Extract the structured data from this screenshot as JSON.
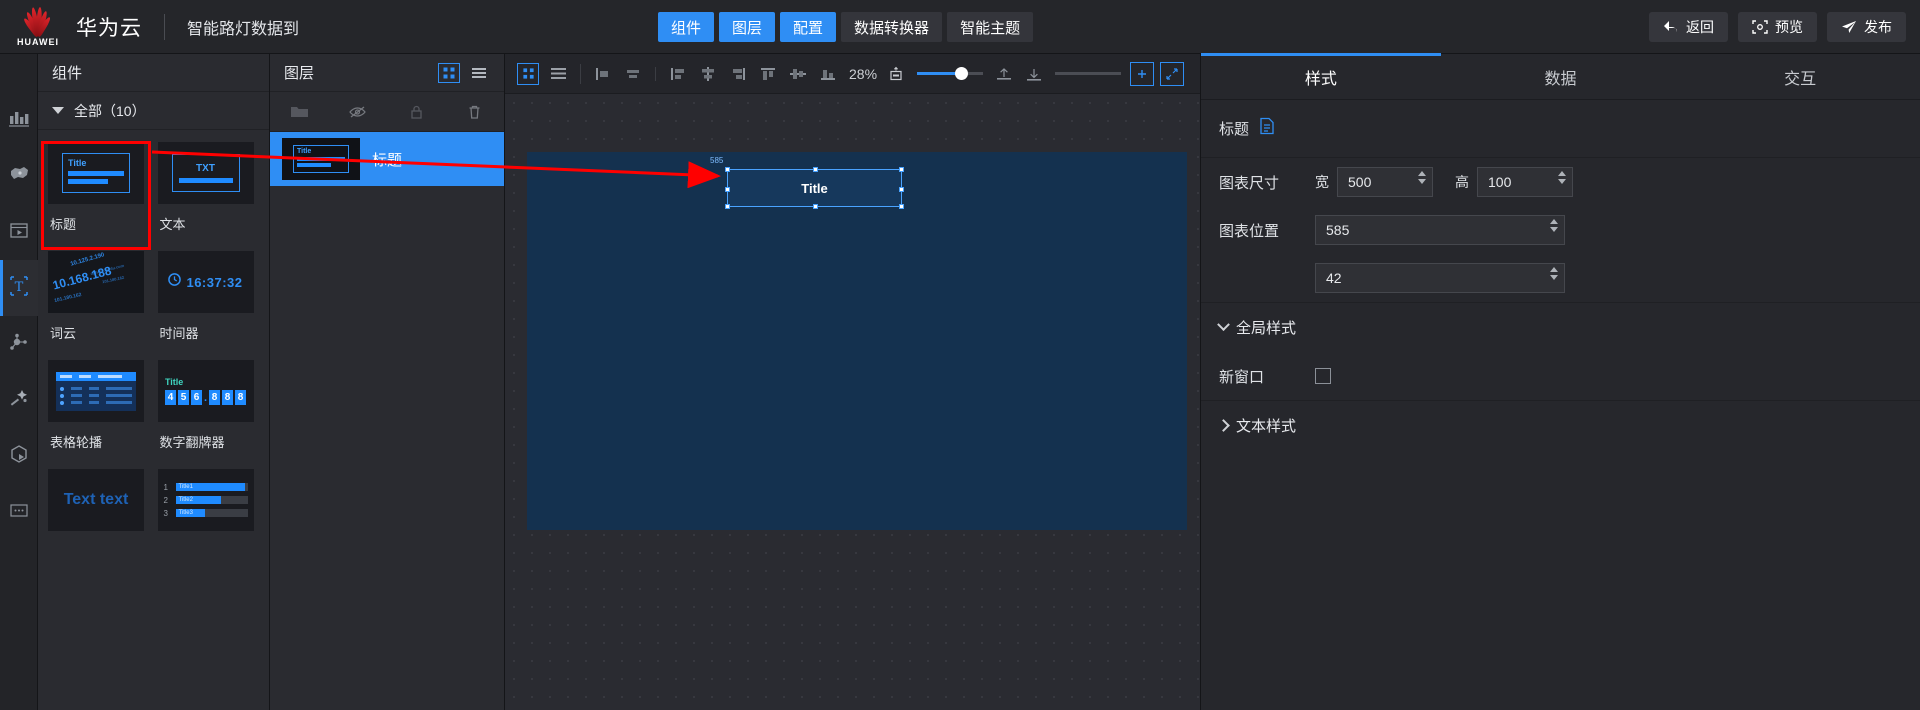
{
  "topbar": {
    "brand_name": "华为云",
    "brand_sub": "HUAWEI",
    "doc_title": "智能路灯数据到",
    "nav": [
      {
        "label": "组件",
        "active": true
      },
      {
        "label": "图层",
        "active": true
      },
      {
        "label": "配置",
        "active": true
      },
      {
        "label": "数据转换器",
        "active": false
      },
      {
        "label": "智能主题",
        "active": false
      }
    ],
    "actions": [
      {
        "label": "返回",
        "icon": "back-arrow-icon"
      },
      {
        "label": "预览",
        "icon": "preview-scan-icon"
      },
      {
        "label": "发布",
        "icon": "publish-send-icon"
      }
    ]
  },
  "rail": {
    "items": [
      {
        "name": "chart-icon",
        "active": false
      },
      {
        "name": "map-icon",
        "active": false
      },
      {
        "name": "media-icon",
        "active": false
      },
      {
        "name": "text-icon",
        "active": true
      },
      {
        "name": "relation-icon",
        "active": false
      },
      {
        "name": "magic-wand-icon",
        "active": false
      },
      {
        "name": "three-d-icon",
        "active": false
      },
      {
        "name": "more-icon",
        "active": false
      }
    ]
  },
  "components_panel": {
    "header": "组件",
    "group_label": "全部（10）",
    "items": [
      {
        "label": "标题",
        "thumb": "title-thumb",
        "selected": true
      },
      {
        "label": "文本",
        "thumb": "txt-thumb",
        "selected": false
      },
      {
        "label": "词云",
        "thumb": "wordcloud-thumb",
        "selected": false
      },
      {
        "label": "时间器",
        "thumb": "clock-thumb",
        "selected": false
      },
      {
        "label": "表格轮播",
        "thumb": "table-carousel-thumb",
        "selected": false
      },
      {
        "label": "数字翻牌器",
        "thumb": "flipnumber-thumb",
        "selected": false
      },
      {
        "label": "",
        "thumb": "texttext-thumb",
        "selected": false
      },
      {
        "label": "",
        "thumb": "ranklist-thumb",
        "selected": false
      }
    ],
    "thumbs": {
      "title_text": "Title",
      "txt_text": "TXT",
      "clock_time": "16:37:32",
      "flip_title": "Title",
      "flip_digits": [
        "4",
        "5",
        "6",
        ".",
        "8",
        "8",
        "8"
      ],
      "texttext": "Text text",
      "wordcloud_words": [
        "10.168.188",
        "10.125.2.190",
        "101.180.162",
        "ophera.baidu.com",
        "101.180.162"
      ],
      "rank_rows": [
        {
          "no": "1",
          "label": "Title1",
          "pct": 96
        },
        {
          "no": "2",
          "label": "Title2",
          "pct": 63
        },
        {
          "no": "3",
          "label": "Title3",
          "pct": 41
        }
      ]
    }
  },
  "layers_panel": {
    "header": "图层",
    "view_icons": [
      "grid-view-icon",
      "list-view-icon"
    ],
    "tool_icons": [
      "folder-icon",
      "eye-off-icon",
      "lock-icon",
      "trash-icon"
    ],
    "layers": [
      {
        "name": "标题",
        "selected": true,
        "thumb_text": "Title"
      }
    ]
  },
  "canvas": {
    "toolbar": {
      "view_icons": [
        "grid-layout-icon",
        "list-layout-icon"
      ],
      "align_icons": [
        "align-left-icon",
        "align-center-h-icon",
        "align-right-icon",
        "distribute-h-icon",
        "align-edge-icon",
        "align-top-icon",
        "align-middle-v-icon",
        "align-bottom-icon"
      ],
      "zoom_level": "28%",
      "fit_icon": "fit-screen-icon",
      "right_icons": [
        "align-up-icon",
        "align-down-icon",
        "add-icon",
        "expand-icon"
      ]
    },
    "widget": {
      "label": "Title",
      "coord_tag": "585"
    }
  },
  "properties": {
    "tabs": [
      {
        "label": "样式",
        "active": true
      },
      {
        "label": "数据",
        "active": false
      },
      {
        "label": "交互",
        "active": false
      }
    ],
    "title_row": {
      "label": "标题",
      "icon": "document-icon"
    },
    "chart_size": {
      "label": "图表尺寸",
      "width_label": "宽",
      "width_value": "500",
      "height_label": "高",
      "height_value": "100"
    },
    "chart_position": {
      "label": "图表位置",
      "x_value": "585",
      "y_value": "42"
    },
    "global_style": {
      "label": "全局样式",
      "expanded": true
    },
    "new_window": {
      "label": "新窗口",
      "checked": false
    },
    "text_style": {
      "label": "文本样式",
      "expanded": false
    }
  },
  "colors": {
    "accent": "#2f8ef4",
    "annotation_red": "#ff0000",
    "canvas_board": "#14314f",
    "topbar_bg": "#25262a"
  }
}
